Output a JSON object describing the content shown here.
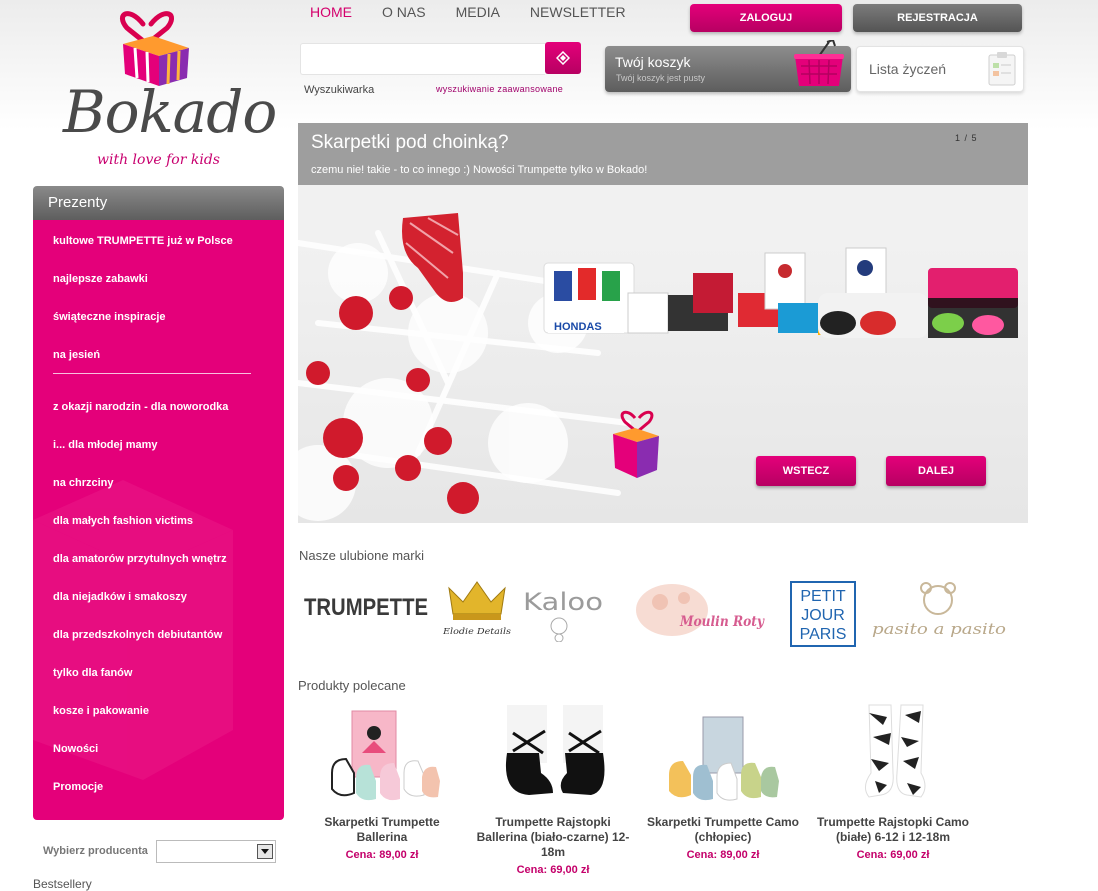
{
  "logo": {
    "name": "Bokado",
    "tagline": "with love for kids"
  },
  "nav": {
    "items": [
      {
        "label": "HOME",
        "active": true
      },
      {
        "label": "O NAS",
        "active": false
      },
      {
        "label": "MEDIA",
        "active": false
      },
      {
        "label": "NEWSLETTER",
        "active": false
      }
    ]
  },
  "account": {
    "login_label": "ZALOGUJ",
    "register_label": "REJESTRACJA"
  },
  "search": {
    "value": "",
    "placeholder": "",
    "label": "Wyszukiwarka",
    "advanced_label": "wyszukiwanie zaawansowane",
    "button_icon": "search-icon"
  },
  "cart": {
    "title": "Twój koszyk",
    "status": "Twój koszyk jest pusty",
    "icon": "basket-icon"
  },
  "wishlist": {
    "label": "Lista życzeń",
    "icon": "clipboard-icon"
  },
  "sidebar": {
    "title": "Prezenty",
    "items_top": [
      "kultowe TRUMPETTE już w Polsce",
      "najlepsze zabawki",
      "świąteczne inspiracje",
      "na jesień"
    ],
    "items_bottom": [
      "z okazji narodzin - dla noworodka",
      "i... dla młodej mamy",
      "na chrzciny",
      "dla małych fashion victims",
      "dla amatorów przytulnych wnętrz",
      "dla niejadków i smakoszy",
      "dla przedszkolnych debiutantów",
      "tylko dla fanów",
      "kosze i pakowanie",
      "Nowości",
      "Promocje"
    ],
    "producer_label": "Wybierz producenta",
    "producer_selected": "",
    "bestsellers_label": "Bestsellery"
  },
  "banner": {
    "title": "Skarpetki pod choinką?",
    "subtitle": "czemu nie! takie - to co innego :) Nowości Trumpette tylko w Bokado!",
    "slide_current": 1,
    "slide_total": 5,
    "counter": "1 / 5",
    "prev_label": "WSTECZ",
    "next_label": "DALEJ",
    "box_text": "HONDAS"
  },
  "brands": {
    "title": "Nasze ulubione marki",
    "items": [
      {
        "name": "TRUMPETTE"
      },
      {
        "name": "Elodie Details"
      },
      {
        "name": "Kaloo"
      },
      {
        "name": "Moulin Roty"
      },
      {
        "line1": "PETIT",
        "line2": "JOUR",
        "line3": "PARIS"
      },
      {
        "name": "pasito a pasito"
      }
    ]
  },
  "products": {
    "title": "Produkty polecane",
    "price_label": "Cena:",
    "items": [
      {
        "name": "Skarpetki Trumpette Ballerina",
        "price": "89,00 zł"
      },
      {
        "name": "Trumpette Rajstopki Ballerina (biało-czarne) 12-18m",
        "price": "69,00 zł"
      },
      {
        "name": "Skarpetki Trumpette Camo (chłopiec)",
        "price": "89,00 zł"
      },
      {
        "name": "Trumpette Rajstopki Camo (białe) 6-12 i 12-18m",
        "price": "69,00 zł"
      }
    ]
  },
  "colors": {
    "brand_pink": "#e4007a",
    "dark_gray": "#5e5e5e",
    "price": "#c4006a"
  }
}
